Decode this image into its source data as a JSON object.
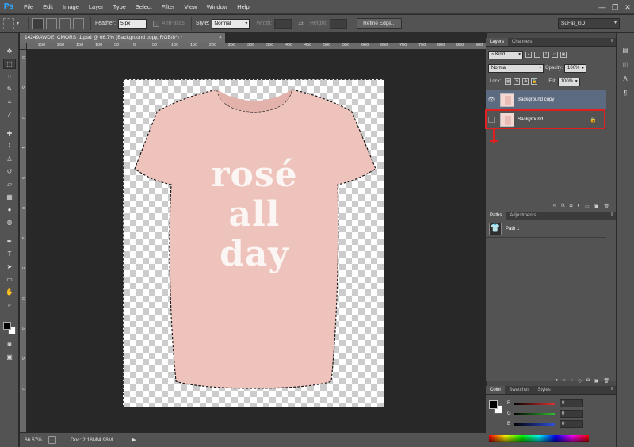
{
  "app": {
    "logo": "Ps",
    "menu": [
      "File",
      "Edit",
      "Image",
      "Layer",
      "Type",
      "Select",
      "Filter",
      "View",
      "Window",
      "Help"
    ],
    "window_controls": {
      "minimize": "—",
      "restore": "❐",
      "close": "✕"
    }
  },
  "options": {
    "feather_label": "Feather:",
    "feather_value": "5 px",
    "antialias_label": "Anti-alias",
    "style_label": "Style:",
    "style_value": "Normal",
    "width_label": "Width:",
    "height_label": "Height:",
    "refine_edge_label": "Refine Edge...",
    "workspace": "SuFal_GD"
  },
  "document": {
    "tab_title": "14249AWDE_CMORS_1.psd @ 66.7% (Background copy, RGB/8*) *",
    "ruler_h_ticks": [
      "250",
      "200",
      "150",
      "100",
      "50",
      "0",
      "50",
      "100",
      "150",
      "200",
      "250",
      "300",
      "350",
      "400",
      "450",
      "500",
      "550",
      "600",
      "650",
      "700",
      "750",
      "800",
      "850",
      "900"
    ],
    "ruler_v_ticks": [
      "0",
      "5",
      "0",
      "1",
      "5",
      "0",
      "2",
      "5",
      "0",
      "3",
      "5",
      "0"
    ],
    "shirt_text": [
      "rosé",
      "all",
      "day"
    ],
    "shirt_color": "#eec3bc"
  },
  "status": {
    "zoom": "66.67%",
    "doc_size": "Doc: 2.18M/4.98M",
    "arrow": "▶"
  },
  "layers_panel": {
    "tabs": [
      "Layers",
      "Channels"
    ],
    "kind_label": "Kind",
    "blend_mode": "Normal",
    "opacity_label": "Opacity:",
    "opacity_value": "100%",
    "lock_label": "Lock:",
    "fill_label": "Fill:",
    "fill_value": "100%",
    "layers": [
      {
        "name": "Background copy",
        "visible": true,
        "selected": true
      },
      {
        "name": "Background",
        "visible": false,
        "locked": true
      }
    ],
    "footer_icons": [
      "∞",
      "fx",
      "◘",
      "◐",
      "▭",
      "▣",
      "🗑"
    ]
  },
  "paths_panel": {
    "tabs": [
      "Paths",
      "Adjustments"
    ],
    "paths": [
      {
        "name": "Path 1"
      }
    ]
  },
  "color_panel": {
    "tabs": [
      "Color",
      "Swatches",
      "Styles"
    ],
    "channels": [
      {
        "letter": "R",
        "value": "0",
        "color": "#e53030"
      },
      {
        "letter": "G",
        "value": "0",
        "color": "#30c030"
      },
      {
        "letter": "B",
        "value": "0",
        "color": "#3050e0"
      }
    ]
  }
}
